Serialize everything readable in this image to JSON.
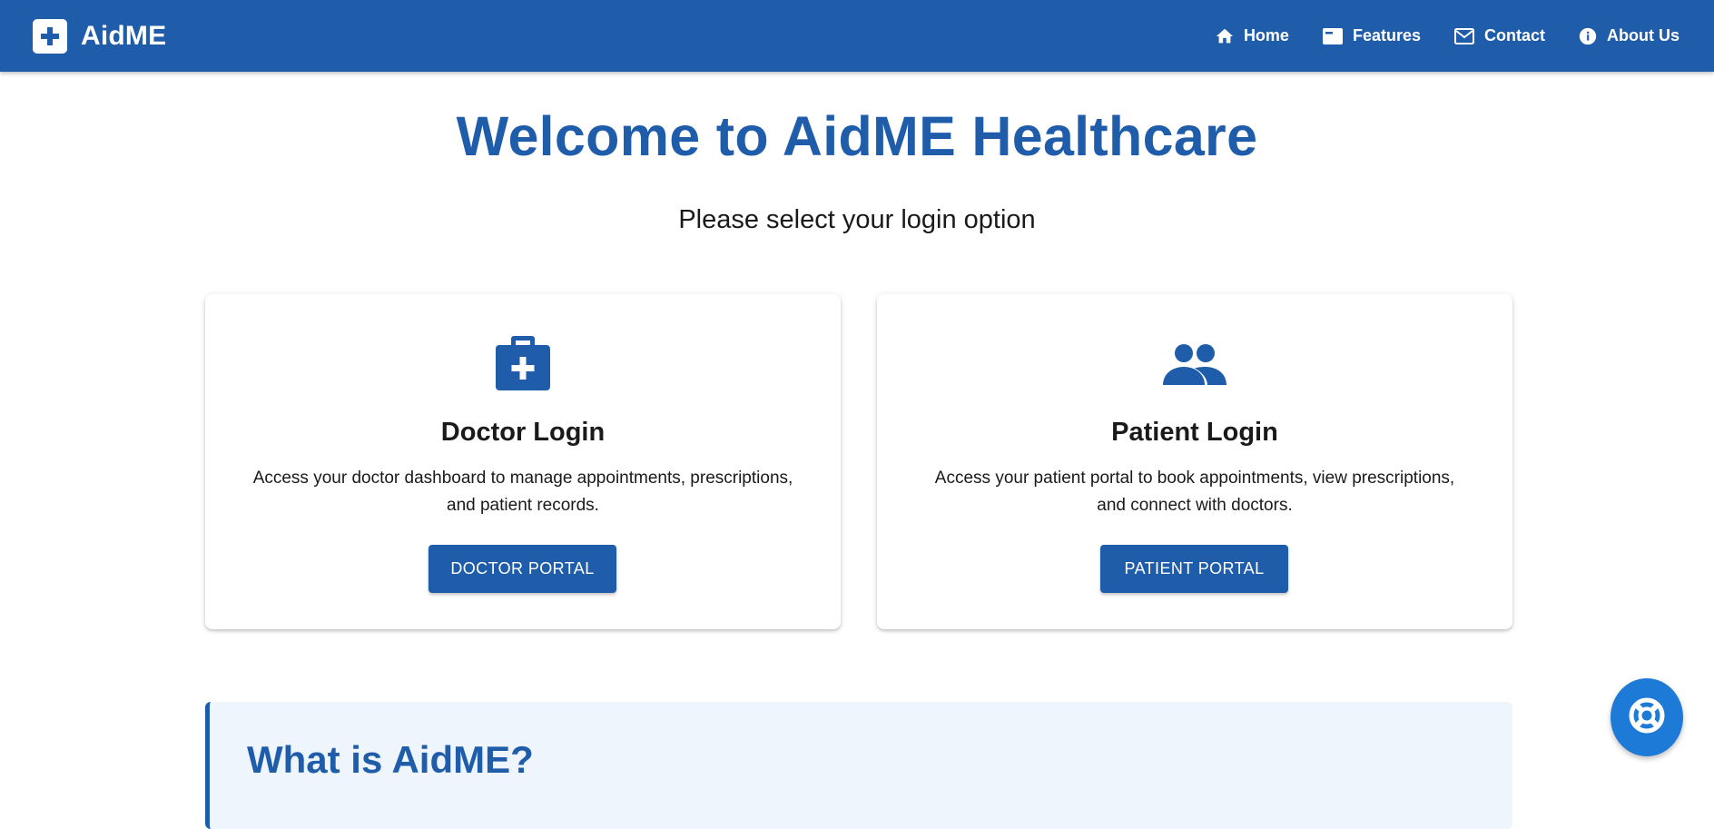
{
  "brand": {
    "name": "AidME",
    "icon": "medical-cross-icon"
  },
  "nav": [
    {
      "label": "Home",
      "icon": "home-icon"
    },
    {
      "label": "Features",
      "icon": "features-icon"
    },
    {
      "label": "Contact",
      "icon": "mail-icon"
    },
    {
      "label": "About Us",
      "icon": "info-icon"
    }
  ],
  "hero": {
    "title": "Welcome to AidME Healthcare",
    "subtitle": "Please select your login option"
  },
  "cards": {
    "doctor": {
      "icon": "medical-bag-icon",
      "title": "Doctor Login",
      "description": "Access your doctor dashboard to manage appointments, prescriptions, and patient records.",
      "button": "DOCTOR PORTAL"
    },
    "patient": {
      "icon": "people-icon",
      "title": "Patient Login",
      "description": "Access your patient portal to book appointments, view prescriptions, and connect with doctors.",
      "button": "PATIENT PORTAL"
    }
  },
  "about": {
    "title": "What is AidME?"
  },
  "fab": {
    "icon": "lifebuoy-icon"
  },
  "colors": {
    "primary": "#1f5dab",
    "fab": "#1e7ad7",
    "about_bg": "#eef5fd"
  }
}
